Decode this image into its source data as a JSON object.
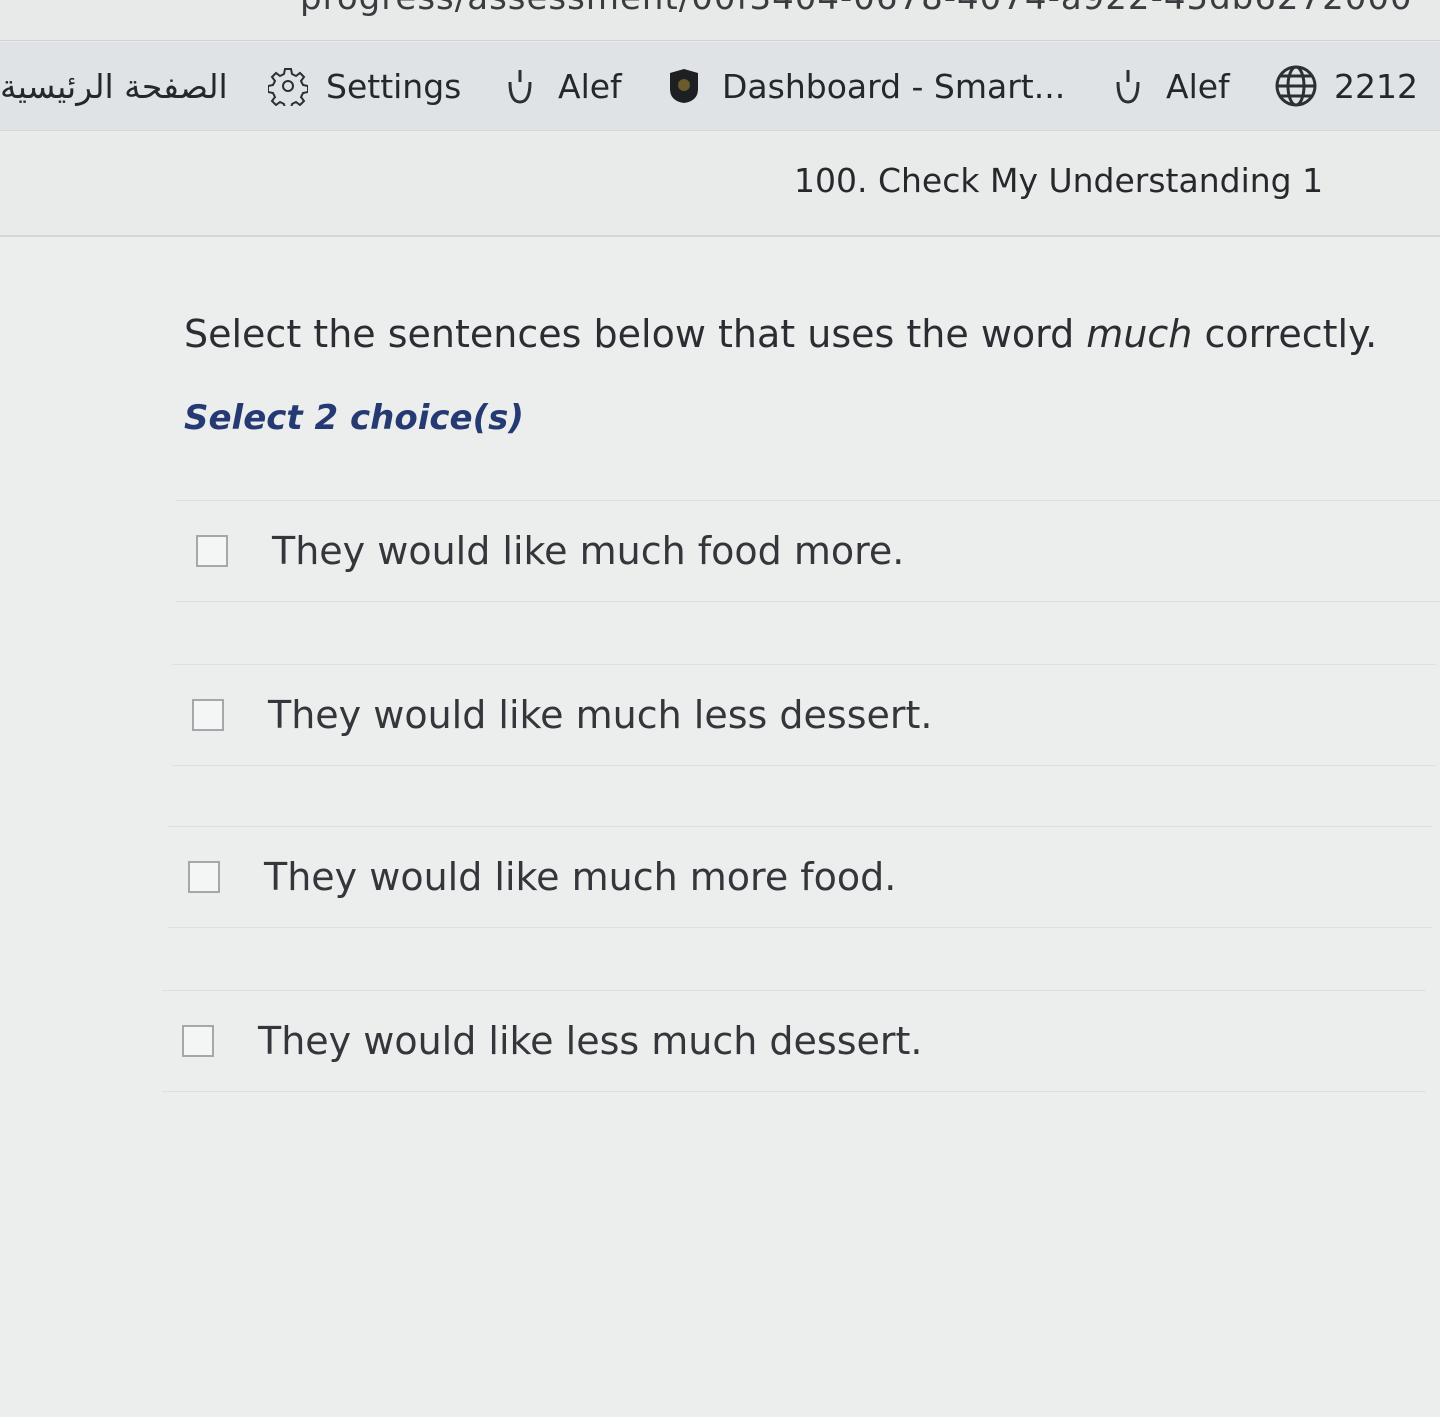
{
  "browser": {
    "url_partial": "progress/assessment/00f3404-0678-4074-a922-45db6272000"
  },
  "bookmarks": [
    {
      "label": "الصفحة الرئيسية",
      "icon": "none"
    },
    {
      "label": "Settings",
      "icon": "gear-icon"
    },
    {
      "label": "Alef",
      "icon": "alef-logo-icon"
    },
    {
      "label": "Dashboard - Smart...",
      "icon": "emblem-icon"
    },
    {
      "label": "Alef",
      "icon": "alef-logo-icon"
    },
    {
      "label": "2212",
      "icon": "globe-icon"
    }
  ],
  "activity": {
    "title": "100. Check My Understanding 1"
  },
  "question": {
    "prefix": "Select the sentences below that uses the word ",
    "emphasis": "much",
    "suffix": " correctly.",
    "instruction": "Select 2 choice(s)"
  },
  "choices": [
    {
      "text": "They would like much food more.",
      "checked": false
    },
    {
      "text": "They would like much less dessert.",
      "checked": false
    },
    {
      "text": "They would like much more food.",
      "checked": false
    },
    {
      "text": "They would like less much dessert.",
      "checked": false
    }
  ],
  "colors": {
    "instruction": "#253a73",
    "page_background": "#eceeee"
  }
}
